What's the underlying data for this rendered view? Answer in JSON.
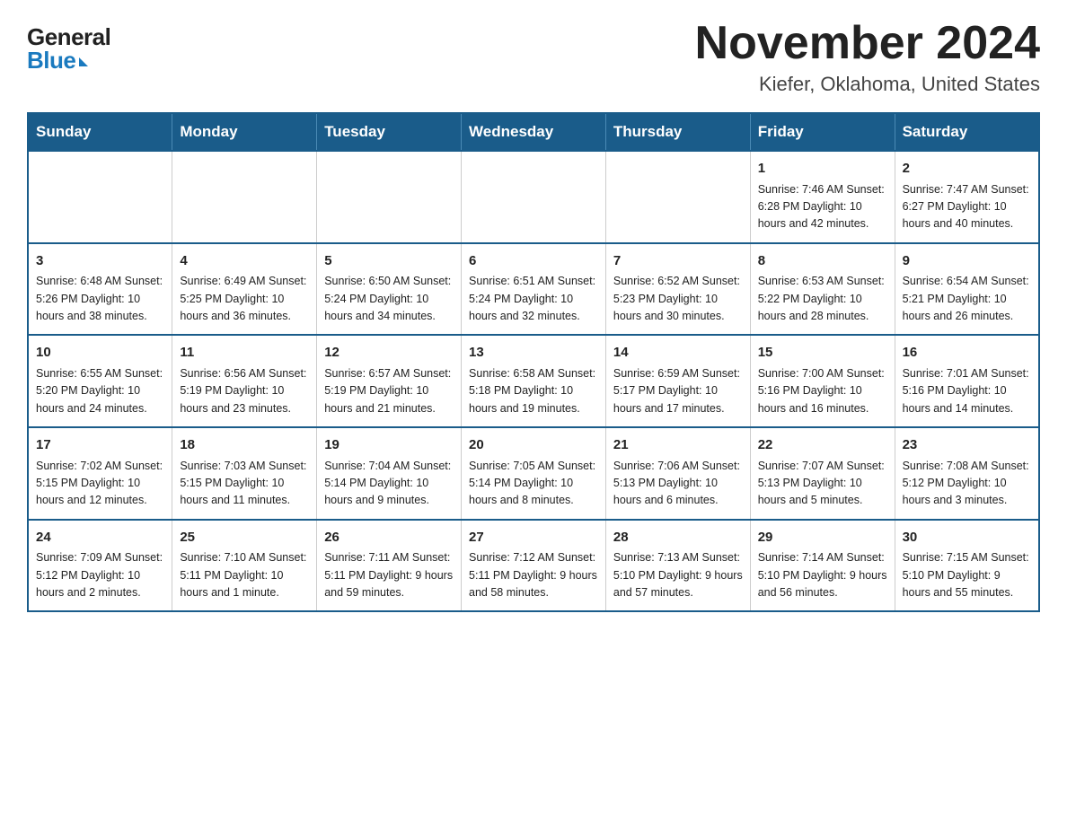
{
  "header": {
    "logo": {
      "general": "General",
      "blue": "Blue"
    },
    "title": "November 2024",
    "location": "Kiefer, Oklahoma, United States"
  },
  "calendar": {
    "days_of_week": [
      "Sunday",
      "Monday",
      "Tuesday",
      "Wednesday",
      "Thursday",
      "Friday",
      "Saturday"
    ],
    "weeks": [
      [
        {
          "day": "",
          "info": ""
        },
        {
          "day": "",
          "info": ""
        },
        {
          "day": "",
          "info": ""
        },
        {
          "day": "",
          "info": ""
        },
        {
          "day": "",
          "info": ""
        },
        {
          "day": "1",
          "info": "Sunrise: 7:46 AM\nSunset: 6:28 PM\nDaylight: 10 hours\nand 42 minutes."
        },
        {
          "day": "2",
          "info": "Sunrise: 7:47 AM\nSunset: 6:27 PM\nDaylight: 10 hours\nand 40 minutes."
        }
      ],
      [
        {
          "day": "3",
          "info": "Sunrise: 6:48 AM\nSunset: 5:26 PM\nDaylight: 10 hours\nand 38 minutes."
        },
        {
          "day": "4",
          "info": "Sunrise: 6:49 AM\nSunset: 5:25 PM\nDaylight: 10 hours\nand 36 minutes."
        },
        {
          "day": "5",
          "info": "Sunrise: 6:50 AM\nSunset: 5:24 PM\nDaylight: 10 hours\nand 34 minutes."
        },
        {
          "day": "6",
          "info": "Sunrise: 6:51 AM\nSunset: 5:24 PM\nDaylight: 10 hours\nand 32 minutes."
        },
        {
          "day": "7",
          "info": "Sunrise: 6:52 AM\nSunset: 5:23 PM\nDaylight: 10 hours\nand 30 minutes."
        },
        {
          "day": "8",
          "info": "Sunrise: 6:53 AM\nSunset: 5:22 PM\nDaylight: 10 hours\nand 28 minutes."
        },
        {
          "day": "9",
          "info": "Sunrise: 6:54 AM\nSunset: 5:21 PM\nDaylight: 10 hours\nand 26 minutes."
        }
      ],
      [
        {
          "day": "10",
          "info": "Sunrise: 6:55 AM\nSunset: 5:20 PM\nDaylight: 10 hours\nand 24 minutes."
        },
        {
          "day": "11",
          "info": "Sunrise: 6:56 AM\nSunset: 5:19 PM\nDaylight: 10 hours\nand 23 minutes."
        },
        {
          "day": "12",
          "info": "Sunrise: 6:57 AM\nSunset: 5:19 PM\nDaylight: 10 hours\nand 21 minutes."
        },
        {
          "day": "13",
          "info": "Sunrise: 6:58 AM\nSunset: 5:18 PM\nDaylight: 10 hours\nand 19 minutes."
        },
        {
          "day": "14",
          "info": "Sunrise: 6:59 AM\nSunset: 5:17 PM\nDaylight: 10 hours\nand 17 minutes."
        },
        {
          "day": "15",
          "info": "Sunrise: 7:00 AM\nSunset: 5:16 PM\nDaylight: 10 hours\nand 16 minutes."
        },
        {
          "day": "16",
          "info": "Sunrise: 7:01 AM\nSunset: 5:16 PM\nDaylight: 10 hours\nand 14 minutes."
        }
      ],
      [
        {
          "day": "17",
          "info": "Sunrise: 7:02 AM\nSunset: 5:15 PM\nDaylight: 10 hours\nand 12 minutes."
        },
        {
          "day": "18",
          "info": "Sunrise: 7:03 AM\nSunset: 5:15 PM\nDaylight: 10 hours\nand 11 minutes."
        },
        {
          "day": "19",
          "info": "Sunrise: 7:04 AM\nSunset: 5:14 PM\nDaylight: 10 hours\nand 9 minutes."
        },
        {
          "day": "20",
          "info": "Sunrise: 7:05 AM\nSunset: 5:14 PM\nDaylight: 10 hours\nand 8 minutes."
        },
        {
          "day": "21",
          "info": "Sunrise: 7:06 AM\nSunset: 5:13 PM\nDaylight: 10 hours\nand 6 minutes."
        },
        {
          "day": "22",
          "info": "Sunrise: 7:07 AM\nSunset: 5:13 PM\nDaylight: 10 hours\nand 5 minutes."
        },
        {
          "day": "23",
          "info": "Sunrise: 7:08 AM\nSunset: 5:12 PM\nDaylight: 10 hours\nand 3 minutes."
        }
      ],
      [
        {
          "day": "24",
          "info": "Sunrise: 7:09 AM\nSunset: 5:12 PM\nDaylight: 10 hours\nand 2 minutes."
        },
        {
          "day": "25",
          "info": "Sunrise: 7:10 AM\nSunset: 5:11 PM\nDaylight: 10 hours\nand 1 minute."
        },
        {
          "day": "26",
          "info": "Sunrise: 7:11 AM\nSunset: 5:11 PM\nDaylight: 9 hours\nand 59 minutes."
        },
        {
          "day": "27",
          "info": "Sunrise: 7:12 AM\nSunset: 5:11 PM\nDaylight: 9 hours\nand 58 minutes."
        },
        {
          "day": "28",
          "info": "Sunrise: 7:13 AM\nSunset: 5:10 PM\nDaylight: 9 hours\nand 57 minutes."
        },
        {
          "day": "29",
          "info": "Sunrise: 7:14 AM\nSunset: 5:10 PM\nDaylight: 9 hours\nand 56 minutes."
        },
        {
          "day": "30",
          "info": "Sunrise: 7:15 AM\nSunset: 5:10 PM\nDaylight: 9 hours\nand 55 minutes."
        }
      ]
    ]
  }
}
